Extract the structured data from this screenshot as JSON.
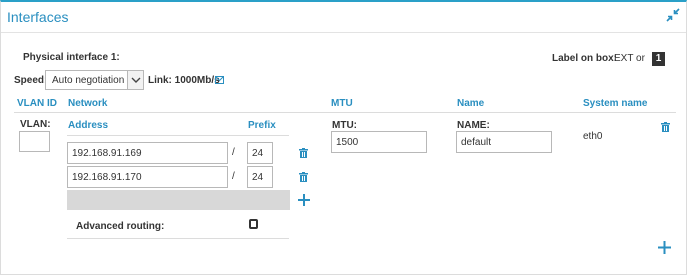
{
  "panel": {
    "title": "Interfaces",
    "collapse_icon": "collapse-arrows-icon"
  },
  "physical_interface": {
    "label": "Physical interface 1:",
    "label_on_box_label": "Label on box:",
    "label_on_box_value": "EXT or",
    "label_on_box_badge": "1"
  },
  "speed": {
    "label": "Speed:",
    "selected": "Auto negotiation",
    "link_text": "Link: 1000Mb/s",
    "link_icon": "mail-icon"
  },
  "columns": {
    "vlan_id": "VLAN ID",
    "network": "Network",
    "mtu": "MTU",
    "name": "Name",
    "system_name": "System name"
  },
  "vlan": {
    "label": "VLAN:",
    "value": ""
  },
  "network": {
    "address_header": "Address",
    "prefix_header": "Prefix",
    "separator": "/",
    "rows": [
      {
        "address": "192.168.91.169",
        "prefix": "24"
      },
      {
        "address": "192.168.91.170",
        "prefix": "24"
      }
    ],
    "advanced_routing_label": "Advanced routing:",
    "advanced_routing_checked": false
  },
  "mtu": {
    "label": "MTU:",
    "value": "1500"
  },
  "name": {
    "label": "NAME:",
    "value": "default"
  },
  "system_name": {
    "value": "eth0"
  },
  "colors": {
    "accent": "#2a8fc0",
    "panel_top_border": "#2aa0c8"
  }
}
